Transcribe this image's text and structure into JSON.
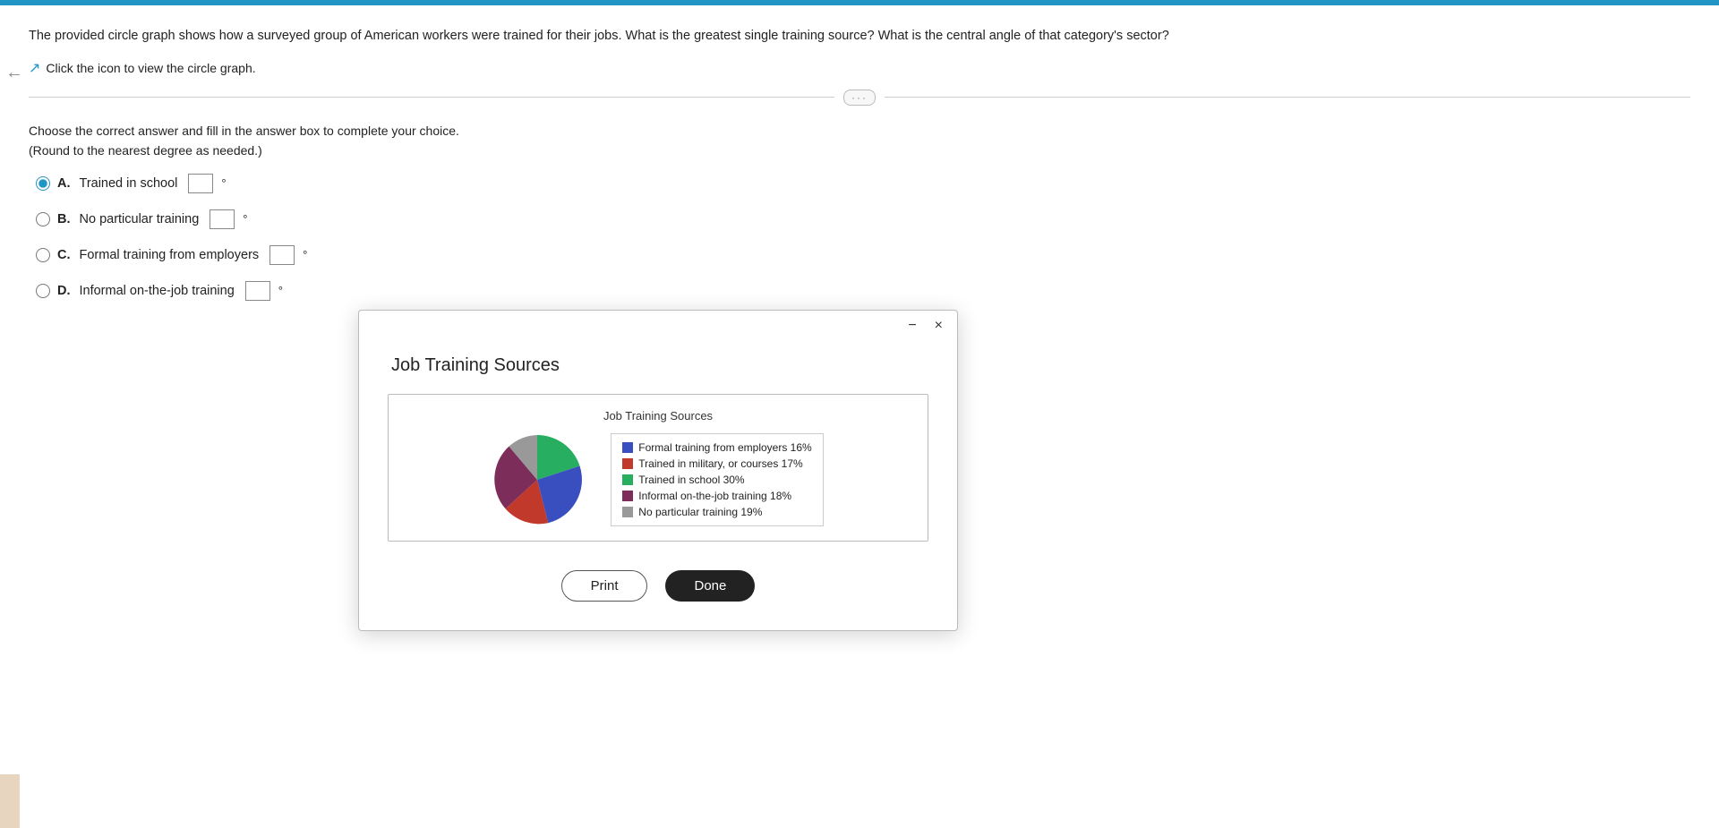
{
  "topBar": {
    "color": "#2196c4"
  },
  "question": {
    "text": "The provided circle graph shows how a surveyed group of American workers were trained for their jobs. What is the greatest single training source? What is the central angle of that category's sector?",
    "clickIconText": "Click the icon to view the circle graph.",
    "instructions1": "Choose the correct answer and fill in the answer box to complete your choice.",
    "instructions2": "(Round to the nearest degree as needed.)",
    "options": [
      {
        "id": "A",
        "label": "A.",
        "text": "Trained in school",
        "checked": true
      },
      {
        "id": "B",
        "label": "B.",
        "text": "No particular training",
        "checked": false
      },
      {
        "id": "C",
        "label": "C.",
        "text": "Formal training from employers",
        "checked": false
      },
      {
        "id": "D",
        "label": "D.",
        "text": "Informal on-the-job training",
        "checked": false
      }
    ]
  },
  "modal": {
    "title": "Job Training Sources",
    "chartTitle": "Job Training Sources",
    "minimizeLabel": "−",
    "closeLabel": "×",
    "legend": [
      {
        "color": "#3a4fbf",
        "text": "Formal training from employers 16%"
      },
      {
        "color": "#c0392b",
        "text": "Trained in military, or courses 17%"
      },
      {
        "color": "#27ae60",
        "text": "Trained in school 30%"
      },
      {
        "color": "#7d2d5a",
        "text": "Informal on-the-job training 18%"
      },
      {
        "color": "#999999",
        "text": "No particular training 19%"
      }
    ],
    "printLabel": "Print",
    "doneLabel": "Done",
    "pieSegments": [
      {
        "color": "#27ae60",
        "percent": 30,
        "label": "Trained in school"
      },
      {
        "color": "#3a4fbf",
        "percent": 16,
        "label": "Formal training from employers"
      },
      {
        "color": "#c0392b",
        "percent": 17,
        "label": "Trained in military"
      },
      {
        "color": "#7d2d5a",
        "percent": 18,
        "label": "Informal on-the-job"
      },
      {
        "color": "#999999",
        "percent": 19,
        "label": "No particular training"
      }
    ]
  },
  "divider": {
    "dotsLabel": "···"
  }
}
